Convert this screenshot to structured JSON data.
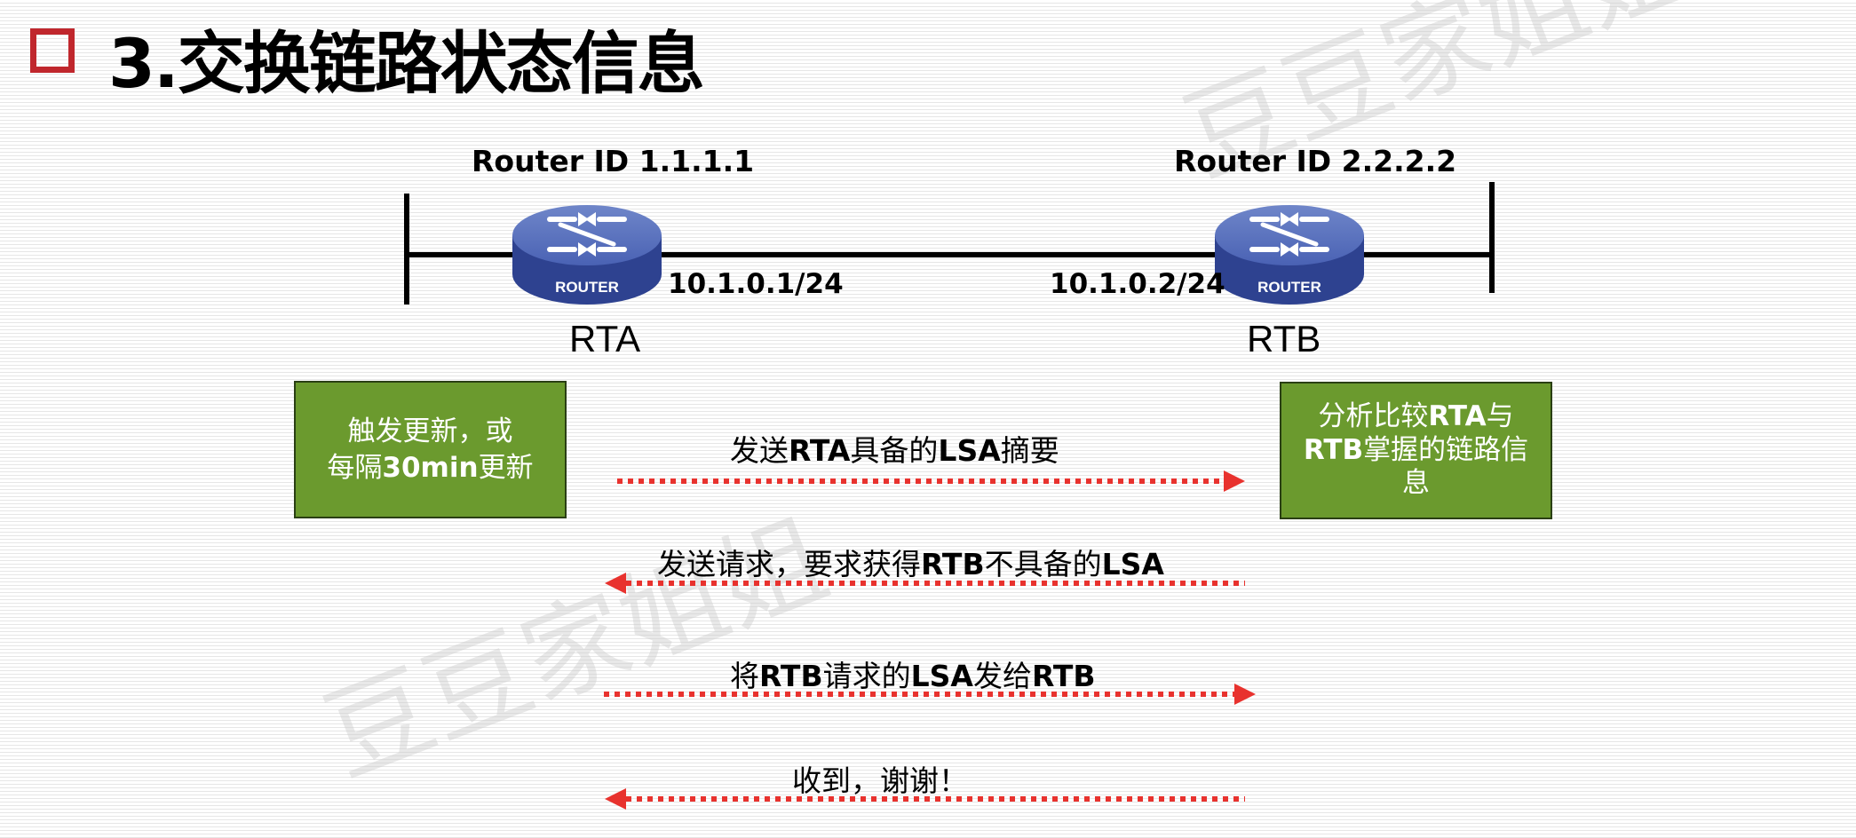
{
  "title": "3.交换链路状态信息",
  "routers": {
    "a": {
      "router_id": "Router ID 1.1.1.1",
      "ip": "10.1.0.1/24",
      "name": "RTA",
      "icon_label": "ROUTER"
    },
    "b": {
      "router_id": "Router ID 2.2.2.2",
      "ip": "10.1.0.2/24",
      "name": "RTB",
      "icon_label": "ROUTER"
    }
  },
  "boxes": {
    "left": {
      "line1": "触发更新，或",
      "line2_pre": "每隔",
      "line2_bold": "30min",
      "line2_post": "更新"
    },
    "right": {
      "l1_pre": "分析比较",
      "l1_bold": "RTA",
      "l1_post": "与",
      "l2_bold": "RTB",
      "l2_post": "掌握的链路信",
      "l3": "息"
    }
  },
  "messages": {
    "m1": {
      "a": "发送",
      "b": "RTA",
      "c": "具备的",
      "d": "LSA",
      "e": "摘要"
    },
    "m2": {
      "a": "发送请求，要求获得",
      "b": "RTB",
      "c": "不具备的",
      "d": "LSA"
    },
    "m3": {
      "a": "将",
      "b": "RTB",
      "c": "请求的",
      "d": "LSA",
      "e": "发给",
      "f": "RTB"
    },
    "m4": {
      "a": "收到，谢谢！"
    }
  },
  "watermark": "豆豆家姐姐",
  "colors": {
    "accent_red": "#c0272d",
    "arrow_red": "#e8322e",
    "box_green": "#6b9a2e",
    "router_blue": "#3f55a5"
  }
}
